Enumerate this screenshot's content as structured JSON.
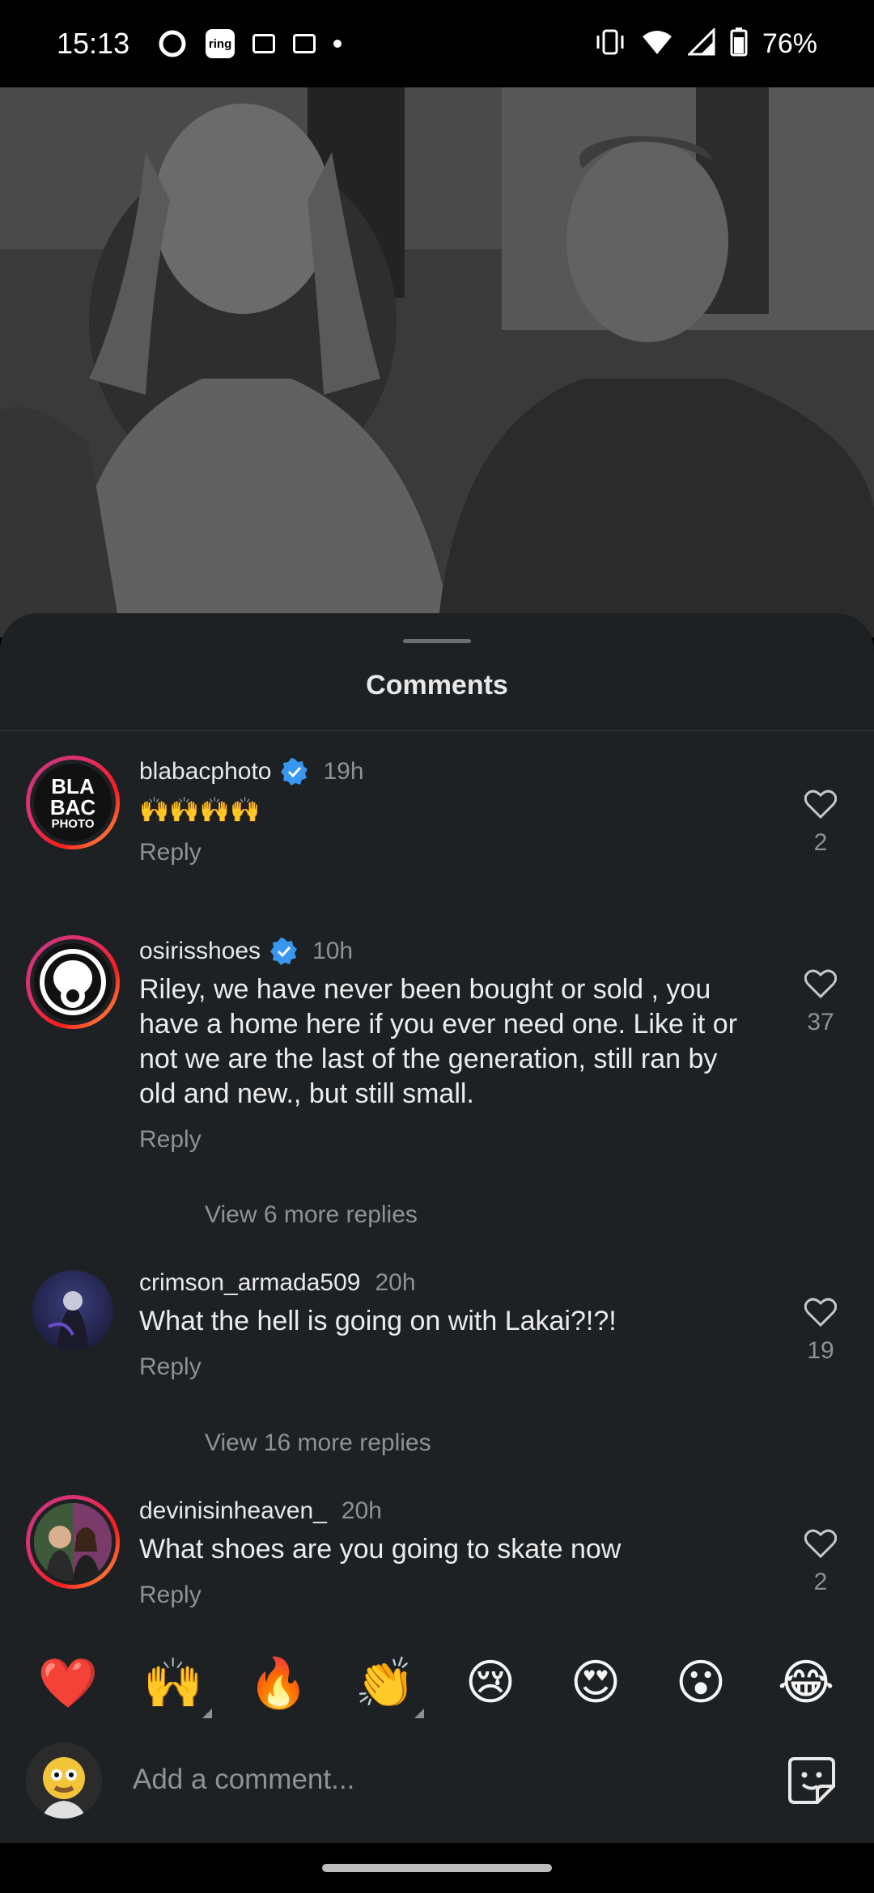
{
  "status_bar": {
    "time": "15:13",
    "ring_label": "ring",
    "battery": "76%",
    "icons": [
      "circle-app-icon",
      "ring-app-icon",
      "card-icon",
      "card-icon",
      "dot-icon",
      "vibrate-icon",
      "wifi-icon",
      "signal-icon",
      "battery-icon"
    ]
  },
  "sheet": {
    "title": "Comments"
  },
  "comments": [
    {
      "username": "blabacphoto",
      "verified": true,
      "time": "19h",
      "text": "🙌🙌🙌🙌",
      "reply_label": "Reply",
      "likes": "2",
      "avatar_text": [
        "BLA",
        "BAC",
        "PHOTO"
      ]
    },
    {
      "username": "osirisshoes",
      "verified": true,
      "time": "10h",
      "text": "Riley, we have never been bought or sold , you have a home here if you ever need one. Like it or not we are the last of the generation, still ran by old and new., but still small.",
      "reply_label": "Reply",
      "likes": "37",
      "more_replies": "View 6 more replies"
    },
    {
      "username": "crimson_armada509",
      "verified": false,
      "time": "20h",
      "text": "What the hell is going on with Lakai?!?!",
      "reply_label": "Reply",
      "likes": "19",
      "more_replies": "View 16 more replies"
    },
    {
      "username": "devinisinheaven_",
      "verified": false,
      "time": "20h",
      "text": "What shoes are you going to skate now",
      "reply_label": "Reply",
      "likes": "2"
    }
  ],
  "reactions": [
    "❤️",
    "🙌",
    "🔥",
    "👏",
    "😢",
    "😍",
    "😮",
    "😂"
  ],
  "compose": {
    "placeholder": "Add a comment..."
  },
  "colors": {
    "sheet_bg": "#1e2124",
    "muted_text": "#8e9196",
    "verified_blue": "#3897f0",
    "story_ring": "#e1306c"
  }
}
